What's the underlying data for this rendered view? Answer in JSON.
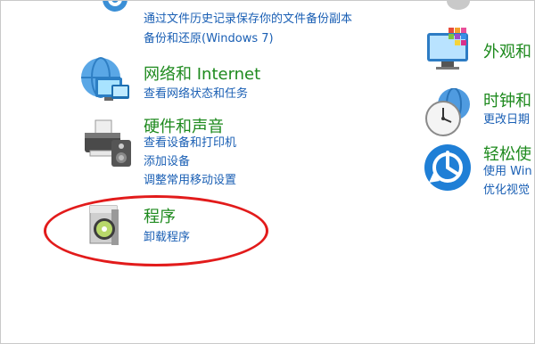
{
  "left": {
    "backup": {
      "links": [
        "通过文件历史记录保存你的文件备份副本",
        "备份和还原(Windows 7)"
      ]
    },
    "network": {
      "title": "网络和 Internet",
      "links": [
        "查看网络状态和任务"
      ]
    },
    "hardware": {
      "title": "硬件和声音",
      "links": [
        "查看设备和打印机",
        "添加设备",
        "调整常用移动设置"
      ]
    },
    "programs": {
      "title": "程序",
      "links": [
        "卸载程序"
      ]
    }
  },
  "right": {
    "appearance": {
      "title": "外观和"
    },
    "clock": {
      "title": "时钟和",
      "links": [
        "更改日期"
      ]
    },
    "ease": {
      "title": "轻松使",
      "links": [
        "使用 Win",
        "优化视觉"
      ]
    }
  },
  "annotation": {
    "color": "#e21b1b"
  }
}
